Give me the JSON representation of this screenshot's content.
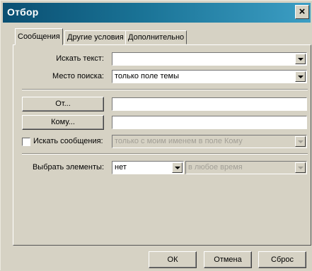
{
  "window": {
    "title": "Отбор",
    "close_glyph": "×"
  },
  "tabs": [
    {
      "label": "Сообщения",
      "active": true
    },
    {
      "label": "Другие условия",
      "active": false
    },
    {
      "label": "Дополнительно",
      "active": false
    }
  ],
  "form": {
    "search_text_label": "Искать текст:",
    "search_text_value": "",
    "search_location_label": "Место поиска:",
    "search_location_value": "только поле темы",
    "from_button": "От...",
    "from_value": "",
    "to_button": "Кому...",
    "to_value": "",
    "search_messages_label": "Искать сообщения:",
    "search_messages_checked": false,
    "search_messages_value": "только с моим именем в поле Кому",
    "select_items_label": "Выбрать элементы:",
    "select_items_value": "нет",
    "time_value": "в любое время"
  },
  "footer": {
    "ok": "ОК",
    "cancel": "Отмена",
    "reset": "Сброс"
  },
  "colors": {
    "title_gradient_start": "#0a4f72",
    "title_gradient_end": "#3c9ec4",
    "face": "#d6d2c4"
  }
}
